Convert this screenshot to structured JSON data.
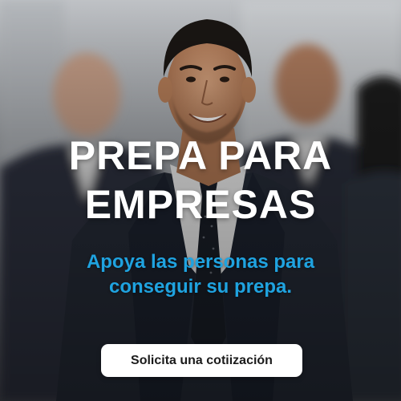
{
  "banner": {
    "headline_line1": "PREPA PARA",
    "headline_line2": "EMPRESAS",
    "subline_line1": "Apoya las personas para",
    "subline_line2": "conseguir su prepa.",
    "cta_label": "Solicita una cotiización"
  },
  "colors": {
    "headline": "#ffffff",
    "accent": "#1fa3e0",
    "button_bg": "#ffffff",
    "button_text": "#1b1b1b"
  }
}
